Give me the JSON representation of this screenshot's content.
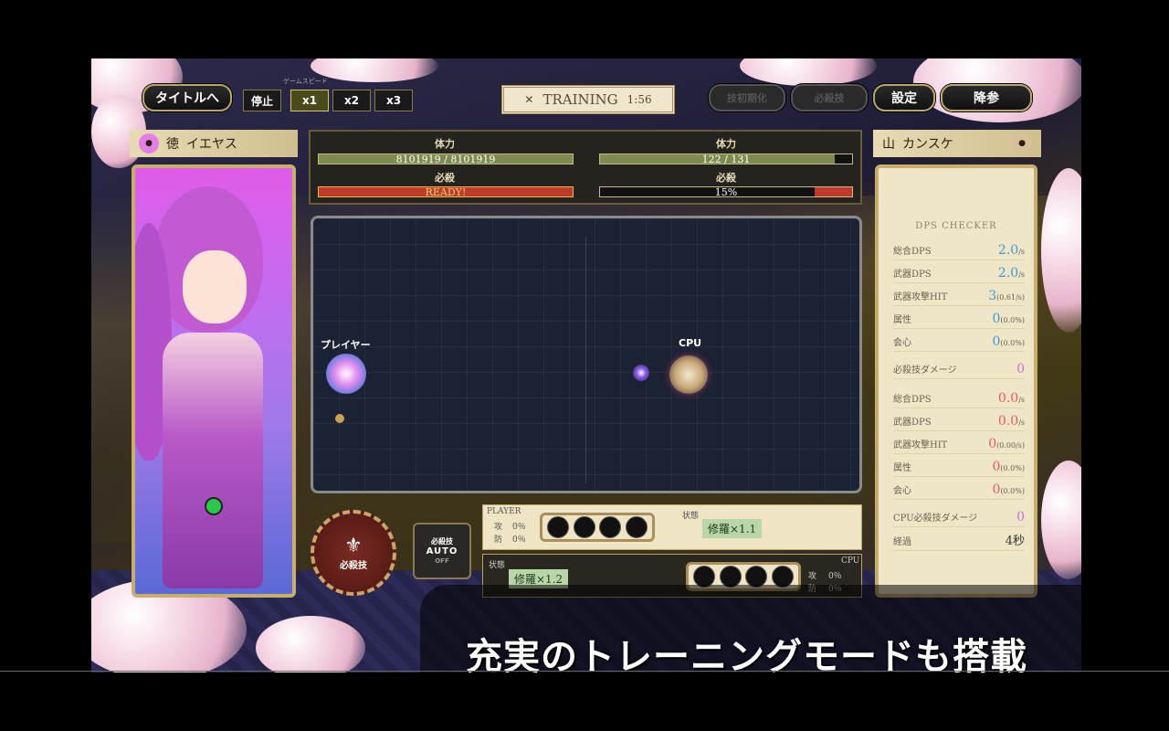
{
  "header": {
    "title_button": "タイトルへ",
    "speed_label": "ゲームスピード",
    "speed_buttons": [
      "停止",
      "x1",
      "x2",
      "x3"
    ],
    "active_speed": "x1",
    "mode": "TRAINING",
    "timer": "1:56",
    "dim_buttons": [
      "技初期化",
      "必殺技"
    ],
    "settings_button": "設定",
    "surrender_button": "降参"
  },
  "player": {
    "surname": "徳",
    "given_name": "イエヤス",
    "hp_label": "体力",
    "hp_text": "8101919 / 8101919",
    "hp_fraction": 1.0,
    "special_label": "必殺",
    "special_text": "READY!",
    "special_fraction": 1.0,
    "arena_label": "プレイヤー"
  },
  "enemy": {
    "surname": "山",
    "given_name": "カンスケ",
    "hp_label": "体力",
    "hp_text": "122 / 131",
    "hp_fraction": 0.93,
    "special_label": "必殺",
    "special_text": "15%",
    "special_fraction": 0.15,
    "arena_label": "CPU"
  },
  "controls": {
    "special_move": "必殺技",
    "auto_title": "必殺技",
    "auto_label": "AUTO",
    "auto_state": "OFF"
  },
  "player_panel": {
    "title": "PLAYER",
    "attack_label": "攻",
    "attack_value": "0％",
    "defense_label": "防",
    "defense_value": "0％",
    "status_label": "状態",
    "status_tag": "修羅×1.1"
  },
  "cpu_panel": {
    "title": "CPU",
    "status_label": "状態",
    "status_tag": "修羅×1.2",
    "attack_label": "攻",
    "attack_value": "0％",
    "defense_label": "防",
    "defense_value": "0％"
  },
  "dps_checker": {
    "title": "DPS CHECKER",
    "player_rows": [
      {
        "label": "総合DPS",
        "value": "2.0",
        "unit": "/s"
      },
      {
        "label": "武器DPS",
        "value": "2.0",
        "unit": "/s"
      },
      {
        "label": "武器攻撃HIT",
        "value": "3",
        "unit": "(0.61/s)"
      },
      {
        "label": "属性",
        "value": "0",
        "unit": "(0.0%)"
      },
      {
        "label": "会心",
        "value": "0",
        "unit": "(0.0%)"
      }
    ],
    "player_special": {
      "label": "必殺技ダメージ",
      "value": "0"
    },
    "cpu_rows": [
      {
        "label": "総合DPS",
        "value": "0.0",
        "unit": "/s"
      },
      {
        "label": "武器DPS",
        "value": "0.0",
        "unit": "/s"
      },
      {
        "label": "武器攻撃HIT",
        "value": "0",
        "unit": "(0.00/s)"
      },
      {
        "label": "属性",
        "value": "0",
        "unit": "(0.0%)"
      },
      {
        "label": "会心",
        "value": "0",
        "unit": "(0.0%)"
      }
    ],
    "cpu_special": {
      "label": "CPU必殺技ダメージ",
      "value": "0"
    },
    "elapsed": {
      "label": "経過",
      "value": "4秒"
    }
  },
  "caption": "充実のトレーニングモードも搭載",
  "colors": {
    "hp_fill": "#7d8c4e",
    "special_fill": "#c0392b",
    "gold_border": "#c9ad6a",
    "player_accent": "#e67ee8",
    "cpu_accent": "#c8a878"
  }
}
